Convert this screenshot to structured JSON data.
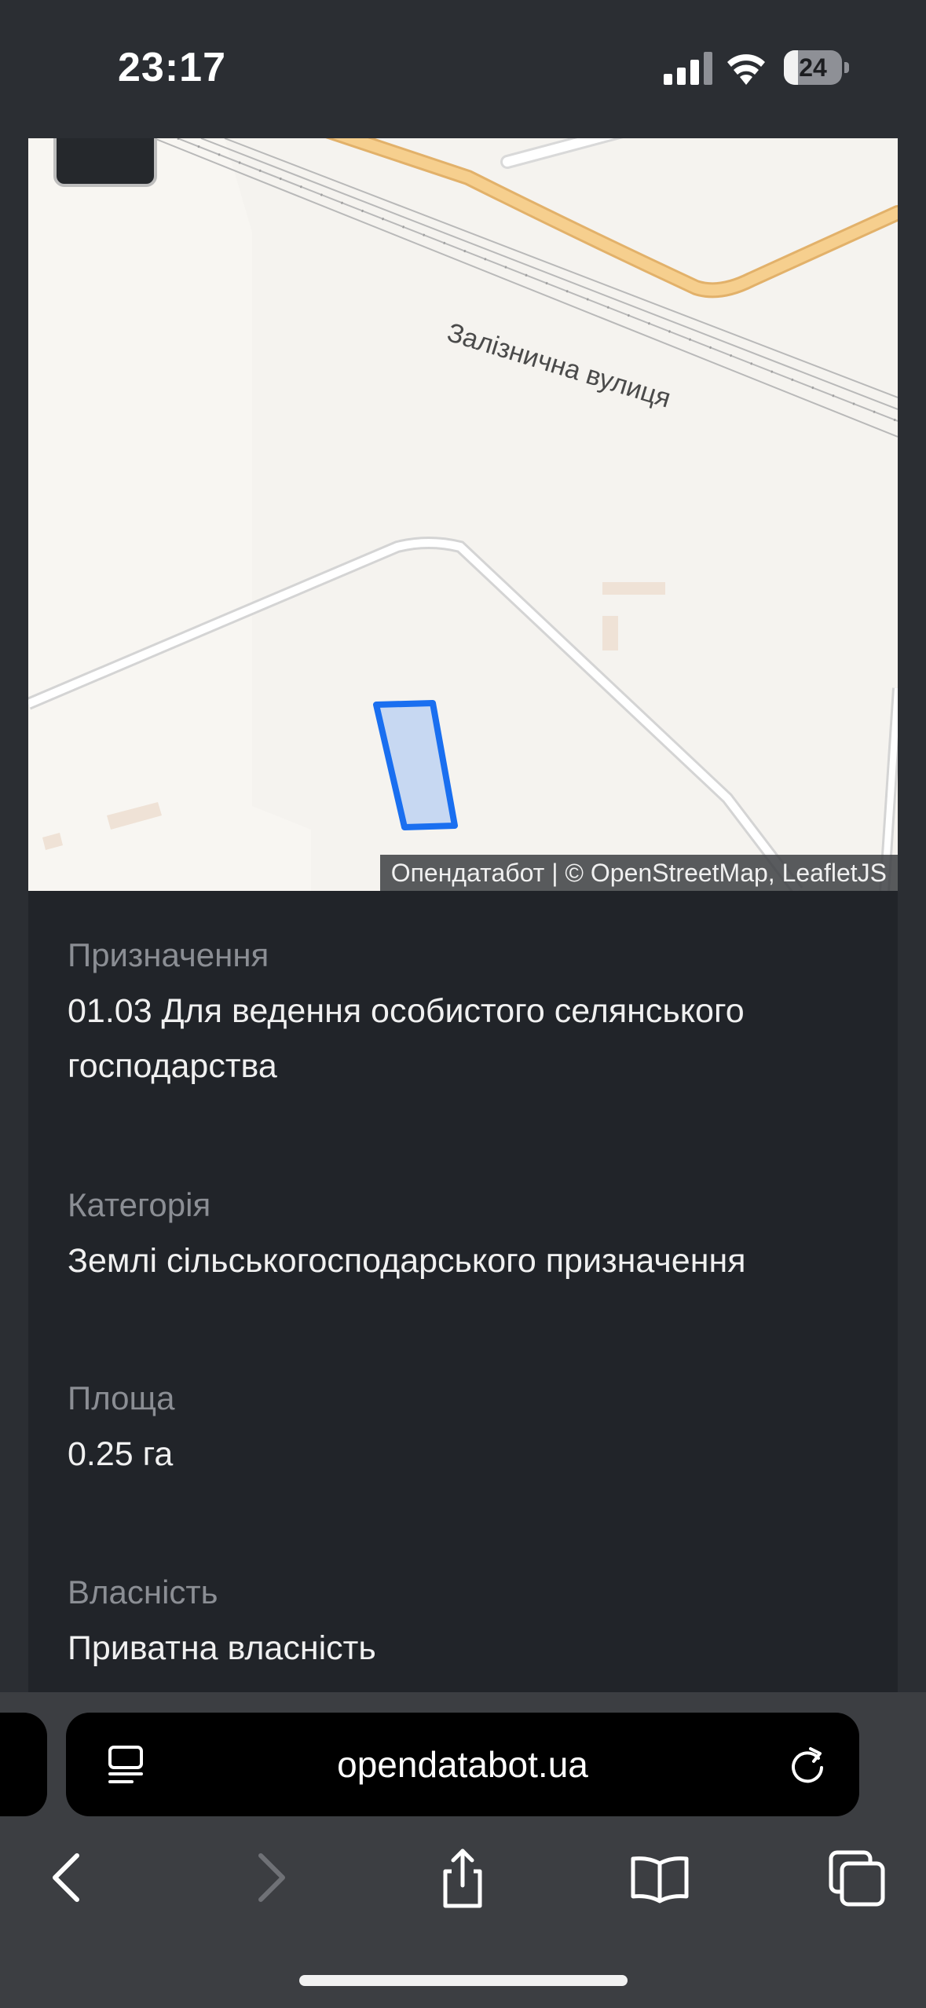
{
  "status_bar": {
    "time": "23:17",
    "battery_level": "24",
    "battery_fraction": 0.24
  },
  "map": {
    "street_label": "Залізнична вулиця",
    "attribution": "Опендатабот | © OpenStreetMap, LeafletJS",
    "colors": {
      "land": "#f5f3ef",
      "road_major": "#f3c989",
      "road_minor": "#ffffff",
      "parcel_fill": "#c7d8f2",
      "parcel_stroke": "#1a6ff0"
    }
  },
  "details": [
    {
      "label": "Призначення",
      "value": "01.03 Для ведення особистого селянського господарства"
    },
    {
      "label": "Категорія",
      "value": "Землі сільськогосподарського призначення"
    },
    {
      "label": "Площа",
      "value": "0.25 га"
    },
    {
      "label": "Власність",
      "value": "Приватна власність"
    }
  ],
  "browser": {
    "url": "opendatabot.ua",
    "icons": {
      "reader": "reader-mode-icon",
      "reload": "reload-icon",
      "back": "back-arrow-icon",
      "forward": "forward-arrow-icon",
      "share": "share-icon",
      "bookmarks": "bookmarks-icon",
      "tabs": "tabs-icon"
    }
  }
}
